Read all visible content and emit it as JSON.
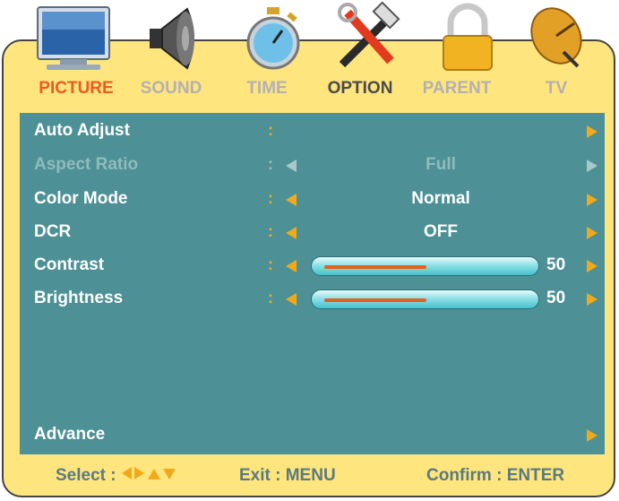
{
  "tabs": [
    {
      "label": "PICTURE",
      "icon": "monitor-icon",
      "state": "active"
    },
    {
      "label": "SOUND",
      "icon": "speaker-icon",
      "state": "normal"
    },
    {
      "label": "TIME",
      "icon": "stopwatch-icon",
      "state": "normal"
    },
    {
      "label": "OPTION",
      "icon": "tools-icon",
      "state": "normal"
    },
    {
      "label": "PARENT",
      "icon": "lock-icon",
      "state": "normal"
    },
    {
      "label": "TV",
      "icon": "satellite-dish-icon",
      "state": "normal"
    }
  ],
  "menu": {
    "auto_adjust": {
      "label": "Auto Adjust",
      "colon": ":"
    },
    "aspect_ratio": {
      "label": "Aspect Ratio",
      "colon": ":",
      "value": "Full",
      "disabled": true
    },
    "color_mode": {
      "label": "Color Mode",
      "colon": ":",
      "value": "Normal"
    },
    "dcr": {
      "label": "DCR",
      "colon": ":",
      "value": "OFF"
    },
    "contrast": {
      "label": "Contrast",
      "colon": ":",
      "value": "50",
      "level": 0.5
    },
    "brightness": {
      "label": "Brightness",
      "colon": ":",
      "value": "50",
      "level": 0.5
    },
    "advance": {
      "label": "Advance"
    }
  },
  "footer": {
    "select": "Select :",
    "exit": "Exit : MENU",
    "confirm": "Confirm : ENTER"
  },
  "colors": {
    "frame": "#fee57d",
    "panel": "#4d9096",
    "active_tab": "#ee5a24",
    "arrow": "#f1a91a",
    "slider_fill": "#e4611c"
  }
}
